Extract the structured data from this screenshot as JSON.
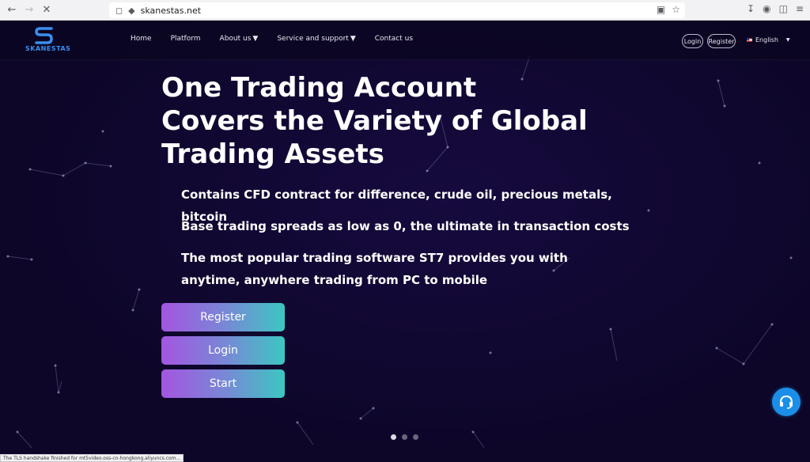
{
  "browser": {
    "url": "skanestas.net",
    "status_text": "The TLS handshake finished for mt5video.oss-cn-hongkong.aliyuncs.com...",
    "icons": [
      "back-icon",
      "forward-icon",
      "stop-loading-icon",
      "shield-icon",
      "lock-icon",
      "install-app-icon",
      "star-icon",
      "download-icon",
      "account-icon",
      "extensions-icon",
      "menu-icon"
    ]
  },
  "site": {
    "logo_text": "SKANESTAS",
    "nav": [
      {
        "label": "Home",
        "dropdown": false
      },
      {
        "label": "Platform",
        "dropdown": false
      },
      {
        "label": "About us",
        "dropdown": true
      },
      {
        "label": "Service and support",
        "dropdown": true
      },
      {
        "label": "Contact us",
        "dropdown": false
      }
    ],
    "login_label": "Login",
    "register_label": "Register",
    "language": "English"
  },
  "hero": {
    "title_lines": [
      "One Trading Account",
      "Covers the Variety of Global",
      "Trading Assets"
    ],
    "features": [
      "Contains CFD contract for difference, crude oil, precious metals, bitcoin",
      "Base trading spreads as low as 0, the ultimate in transaction costs",
      "The most popular trading software ST7 provides you with anytime, anywhere trading from PC to mobile"
    ],
    "buttons": [
      "Register",
      "Login",
      "Start"
    ]
  },
  "carousel": {
    "slides": 3,
    "active_index": 0
  },
  "colors": {
    "background": "#0d0628",
    "accent_gradient_start": "#a356e0",
    "accent_gradient_end": "#3cc7c2",
    "logo_blue": "#3a8ff0",
    "support_button": "#1b8fe8"
  }
}
